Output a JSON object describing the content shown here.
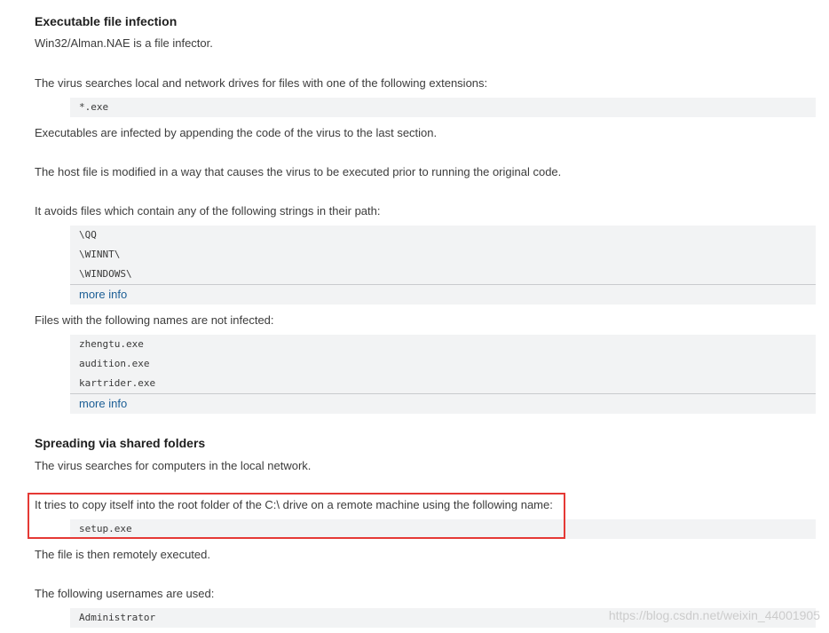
{
  "section1": {
    "heading": "Executable file infection",
    "p1": "Win32/Alman.NAE is a file infector.",
    "p2": "The virus searches local and network drives for files with one of the following extensions:",
    "code1": [
      "*.exe"
    ],
    "p3": "Executables are infected by appending the code of the virus to the last section.",
    "p4": "The host file is modified in a way that causes the virus to be executed prior to running the original code.",
    "p5": "It avoids files which contain any of the following strings in their path:",
    "code2": [
      "\\QQ",
      "\\WINNT\\",
      "\\WINDOWS\\"
    ],
    "more_info_1": "more info",
    "p6": "Files with the following names are not infected:",
    "code3": [
      "zhengtu.exe",
      "audition.exe",
      "kartrider.exe"
    ],
    "more_info_2": "more info"
  },
  "section2": {
    "heading": "Spreading via shared folders",
    "p1": "The virus searches for computers in the local network.",
    "p2": "It tries to copy itself into the root folder of the C:\\ drive on a remote machine using the following name:",
    "code1": [
      "setup.exe"
    ],
    "p3": "The file is then remotely executed.",
    "p4": "The following usernames are used:",
    "code2": [
      "Administrator"
    ]
  },
  "watermark": "https://blog.csdn.net/weixin_44001905",
  "colors": {
    "code_bg": "#f2f3f4",
    "link": "#1d5f96",
    "highlight_border": "#e53935"
  }
}
